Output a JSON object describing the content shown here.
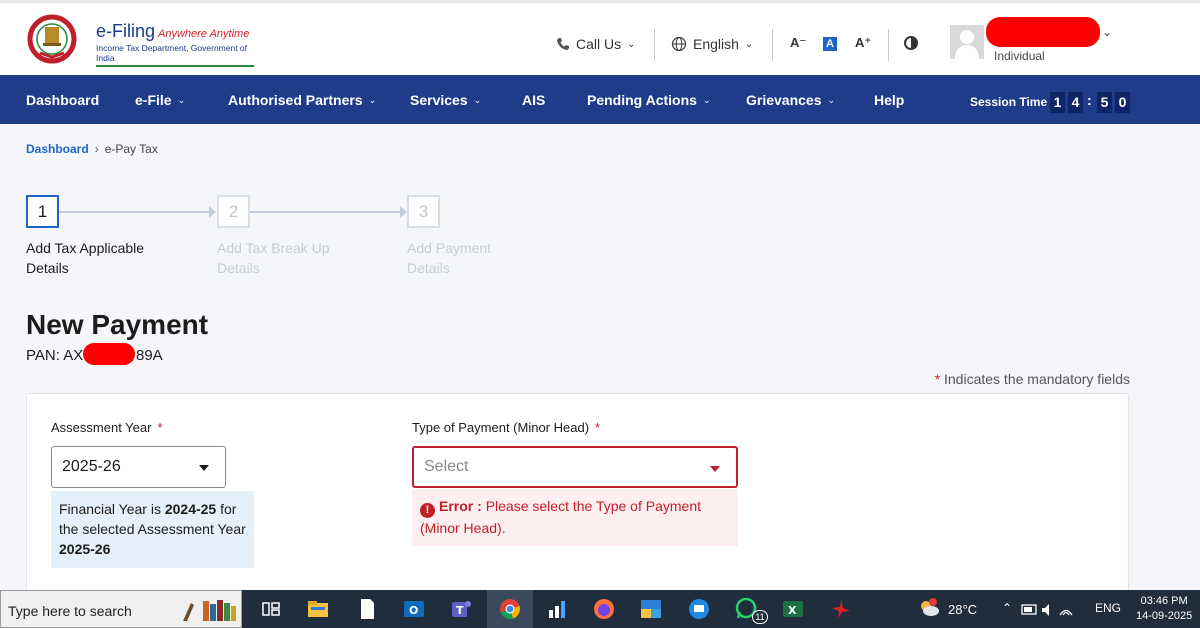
{
  "header": {
    "logo_title": "e-Filing",
    "logo_tagline": "Anywhere Anytime",
    "logo_subtitle": "Income Tax Department, Government of India",
    "call_us": "Call Us",
    "language": "English",
    "font_decrease": "A⁻",
    "font_normal": "A",
    "font_increase": "A⁺",
    "user_type": "Individual"
  },
  "nav": {
    "items": [
      {
        "label": "Dashboard",
        "has_menu": false
      },
      {
        "label": "e-File",
        "has_menu": true
      },
      {
        "label": "Authorised Partners",
        "has_menu": true
      },
      {
        "label": "Services",
        "has_menu": true
      },
      {
        "label": "AIS",
        "has_menu": false
      },
      {
        "label": "Pending Actions",
        "has_menu": true
      },
      {
        "label": "Grievances",
        "has_menu": true
      },
      {
        "label": "Help",
        "has_menu": false
      }
    ],
    "session_label": "Session Time",
    "session_digits": [
      "1",
      "4",
      "5",
      "0"
    ]
  },
  "breadcrumb": {
    "home": "Dashboard",
    "current": "e-Pay Tax"
  },
  "stepper": {
    "steps": [
      {
        "number": "1",
        "line1": "Add Tax Applicable",
        "line2": "Details"
      },
      {
        "number": "2",
        "line1": "Add Tax Break Up",
        "line2": "Details"
      },
      {
        "number": "3",
        "line1": "Add Payment",
        "line2": "Details"
      }
    ],
    "current_step": 1
  },
  "page": {
    "title": "New Payment",
    "pan_prefix": "PAN: AX",
    "pan_suffix": "89A",
    "mandatory_note": "Indicates the mandatory fields"
  },
  "form": {
    "assessment_year": {
      "label": "Assessment Year",
      "value": "2025-26",
      "info_prefix": "Financial Year is",
      "info_fy": "2024-25",
      "info_mid": "for the selected Assessment Year",
      "info_ay": "2025-26"
    },
    "payment_type": {
      "label": "Type of Payment (Minor Head)",
      "placeholder": "Select",
      "error_label": "Error :",
      "error_message": "Please select the Type of Payment (Minor Head)."
    }
  },
  "taskbar": {
    "search_placeholder": "Type here to search",
    "whatsapp_badge": "11",
    "temperature": "28°C",
    "language": "ENG",
    "time": "03:46 PM",
    "date": "14-09-2025"
  },
  "colors": {
    "nav_bg": "#1f3c8a",
    "accent_blue": "#1e65c9",
    "error_red": "#c0202b",
    "info_bg": "#e4f0fb"
  }
}
